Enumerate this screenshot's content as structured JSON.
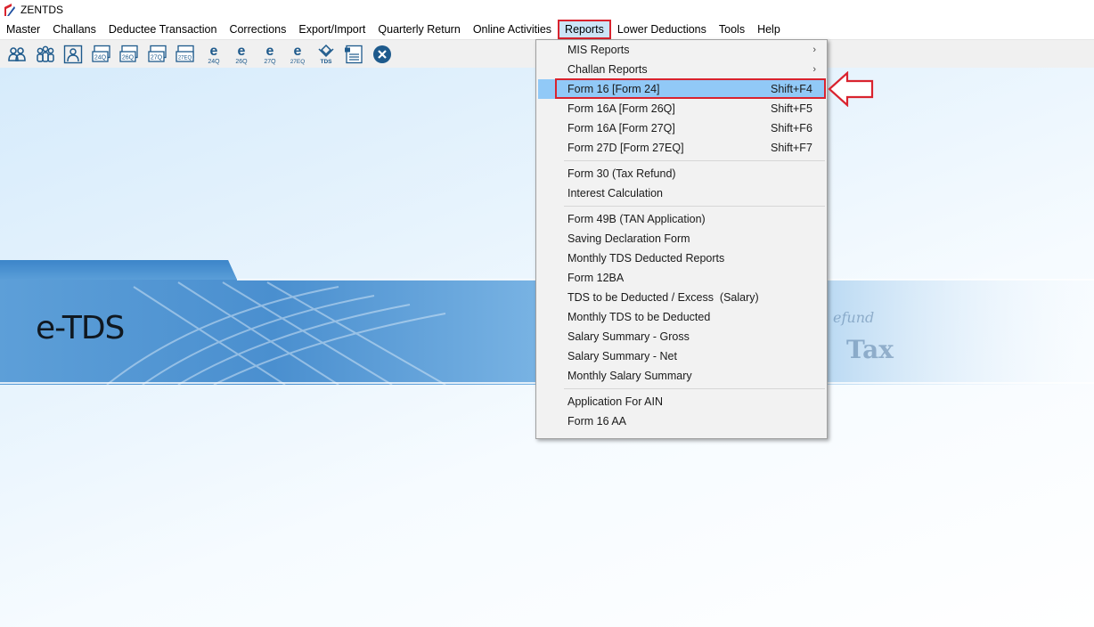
{
  "app": {
    "title": "ZENTDS"
  },
  "menubar": {
    "items": [
      {
        "label": "Master"
      },
      {
        "label": "Challans"
      },
      {
        "label": "Deductee Transaction"
      },
      {
        "label": "Corrections"
      },
      {
        "label": "Export/Import"
      },
      {
        "label": "Quarterly Return"
      },
      {
        "label": "Online Activities"
      },
      {
        "label": "Reports"
      },
      {
        "label": "Lower Deductions"
      },
      {
        "label": "Tools"
      },
      {
        "label": "Help"
      }
    ]
  },
  "toolbar": {
    "buttons": [
      {
        "icon": "deductor-icon"
      },
      {
        "icon": "deductees-icon"
      },
      {
        "icon": "employee-icon"
      },
      {
        "icon": "form-24q-icon",
        "text": "24Q"
      },
      {
        "icon": "form-26q-icon",
        "text": "26Q"
      },
      {
        "icon": "form-27q-icon",
        "text": "27Q"
      },
      {
        "icon": "form-27eq-icon",
        "text": "27EQ"
      },
      {
        "icon": "efile-24q-icon",
        "text": "24Q"
      },
      {
        "icon": "efile-26q-icon",
        "text": "26Q"
      },
      {
        "icon": "efile-27q-icon",
        "text": "27Q"
      },
      {
        "icon": "efile-27eq-icon",
        "text": "27EQ"
      },
      {
        "icon": "tds-icon",
        "text": "TDS"
      },
      {
        "icon": "report-icon"
      },
      {
        "icon": "close-icon"
      }
    ]
  },
  "banner": {
    "title": "e-TDS"
  },
  "reports_menu": {
    "items": [
      {
        "label": "MIS Reports",
        "submenu": true
      },
      {
        "label": "Challan Reports",
        "submenu": true
      },
      {
        "label": "Form 16 [Form 24]",
        "shortcut": "Shift+F4",
        "highlighted": true
      },
      {
        "label": "Form 16A [Form 26Q]",
        "shortcut": "Shift+F5"
      },
      {
        "label": "Form 16A [Form 27Q]",
        "shortcut": "Shift+F6"
      },
      {
        "label": "Form 27D [Form 27EQ]",
        "shortcut": "Shift+F7"
      },
      {
        "label": "Form 30 (Tax Refund)"
      },
      {
        "label": "Interest Calculation"
      },
      {
        "label": "Form 49B (TAN Application)"
      },
      {
        "label": "Saving Declaration Form"
      },
      {
        "label": "Monthly TDS Deducted Reports"
      },
      {
        "label": "Form 12BA"
      },
      {
        "label": "TDS to be Deducted / Excess  (Salary)"
      },
      {
        "label": "Monthly TDS to be Deducted"
      },
      {
        "label": "Salary Summary - Gross"
      },
      {
        "label": "Salary Summary - Net"
      },
      {
        "label": "Monthly Salary Summary"
      },
      {
        "label": "Application For AIN"
      },
      {
        "label": "Form 16 AA"
      }
    ],
    "submenu_arrow": "›"
  },
  "colors": {
    "accent_red": "#d9232e",
    "menu_highlight": "#91c9f7",
    "toolbar_icon": "#1e5a8c"
  }
}
